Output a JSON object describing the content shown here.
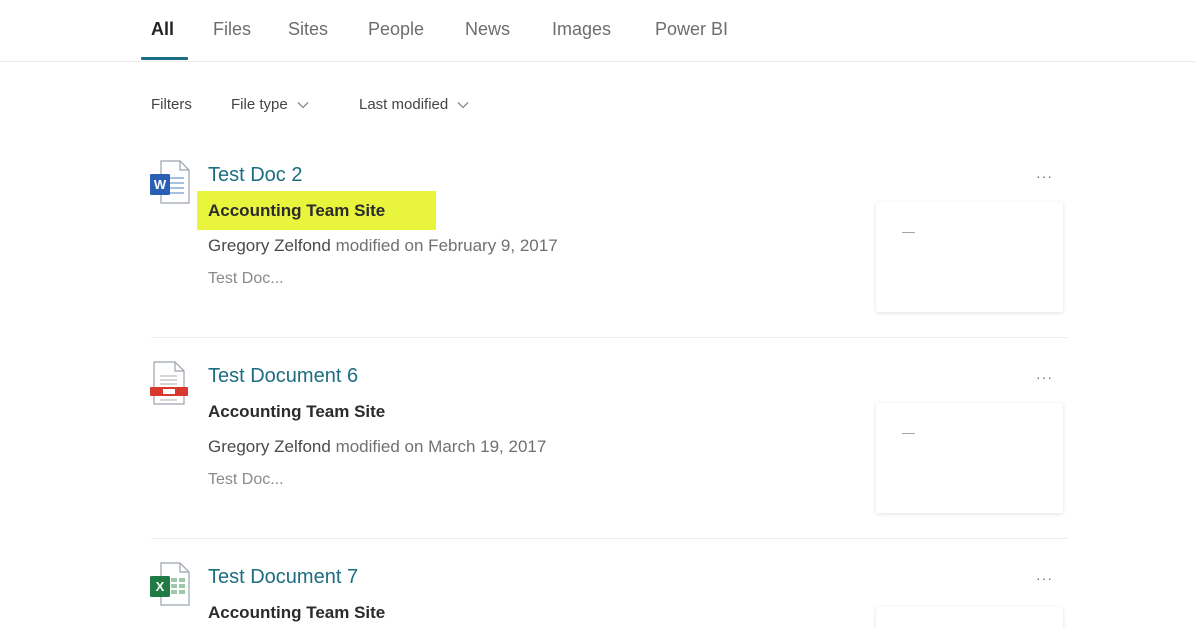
{
  "tabs": [
    {
      "label": "All",
      "active": true
    },
    {
      "label": "Files"
    },
    {
      "label": "Sites"
    },
    {
      "label": "People"
    },
    {
      "label": "News"
    },
    {
      "label": "Images"
    },
    {
      "label": "Power BI"
    }
  ],
  "filters": {
    "label": "Filters",
    "file_type": "File type",
    "last_modified": "Last modified"
  },
  "results": [
    {
      "title": "Test Doc 2",
      "site": "Accounting Team Site",
      "author": "Gregory Zelfond",
      "modified": " modified on February 9, 2017",
      "snippet": "Test Doc...",
      "more": "···",
      "thumb_text": "—",
      "icon": "word-doc-icon",
      "highlighted": true
    },
    {
      "title": "Test Document 6",
      "site": "Accounting Team Site",
      "author": "Gregory Zelfond",
      "modified": " modified on March 19, 2017",
      "snippet": "Test Doc...",
      "more": "···",
      "thumb_text": "—",
      "icon": "pdf-doc-icon"
    },
    {
      "title": "Test Document 7",
      "site": "Accounting Team Site",
      "more": "···",
      "icon": "excel-doc-icon"
    }
  ],
  "colors": {
    "accent": "#1b6e83",
    "highlight": "#e9f53c",
    "word": "#2b5fb4",
    "pdf": "#d9382f",
    "excel": "#1f7a43"
  }
}
